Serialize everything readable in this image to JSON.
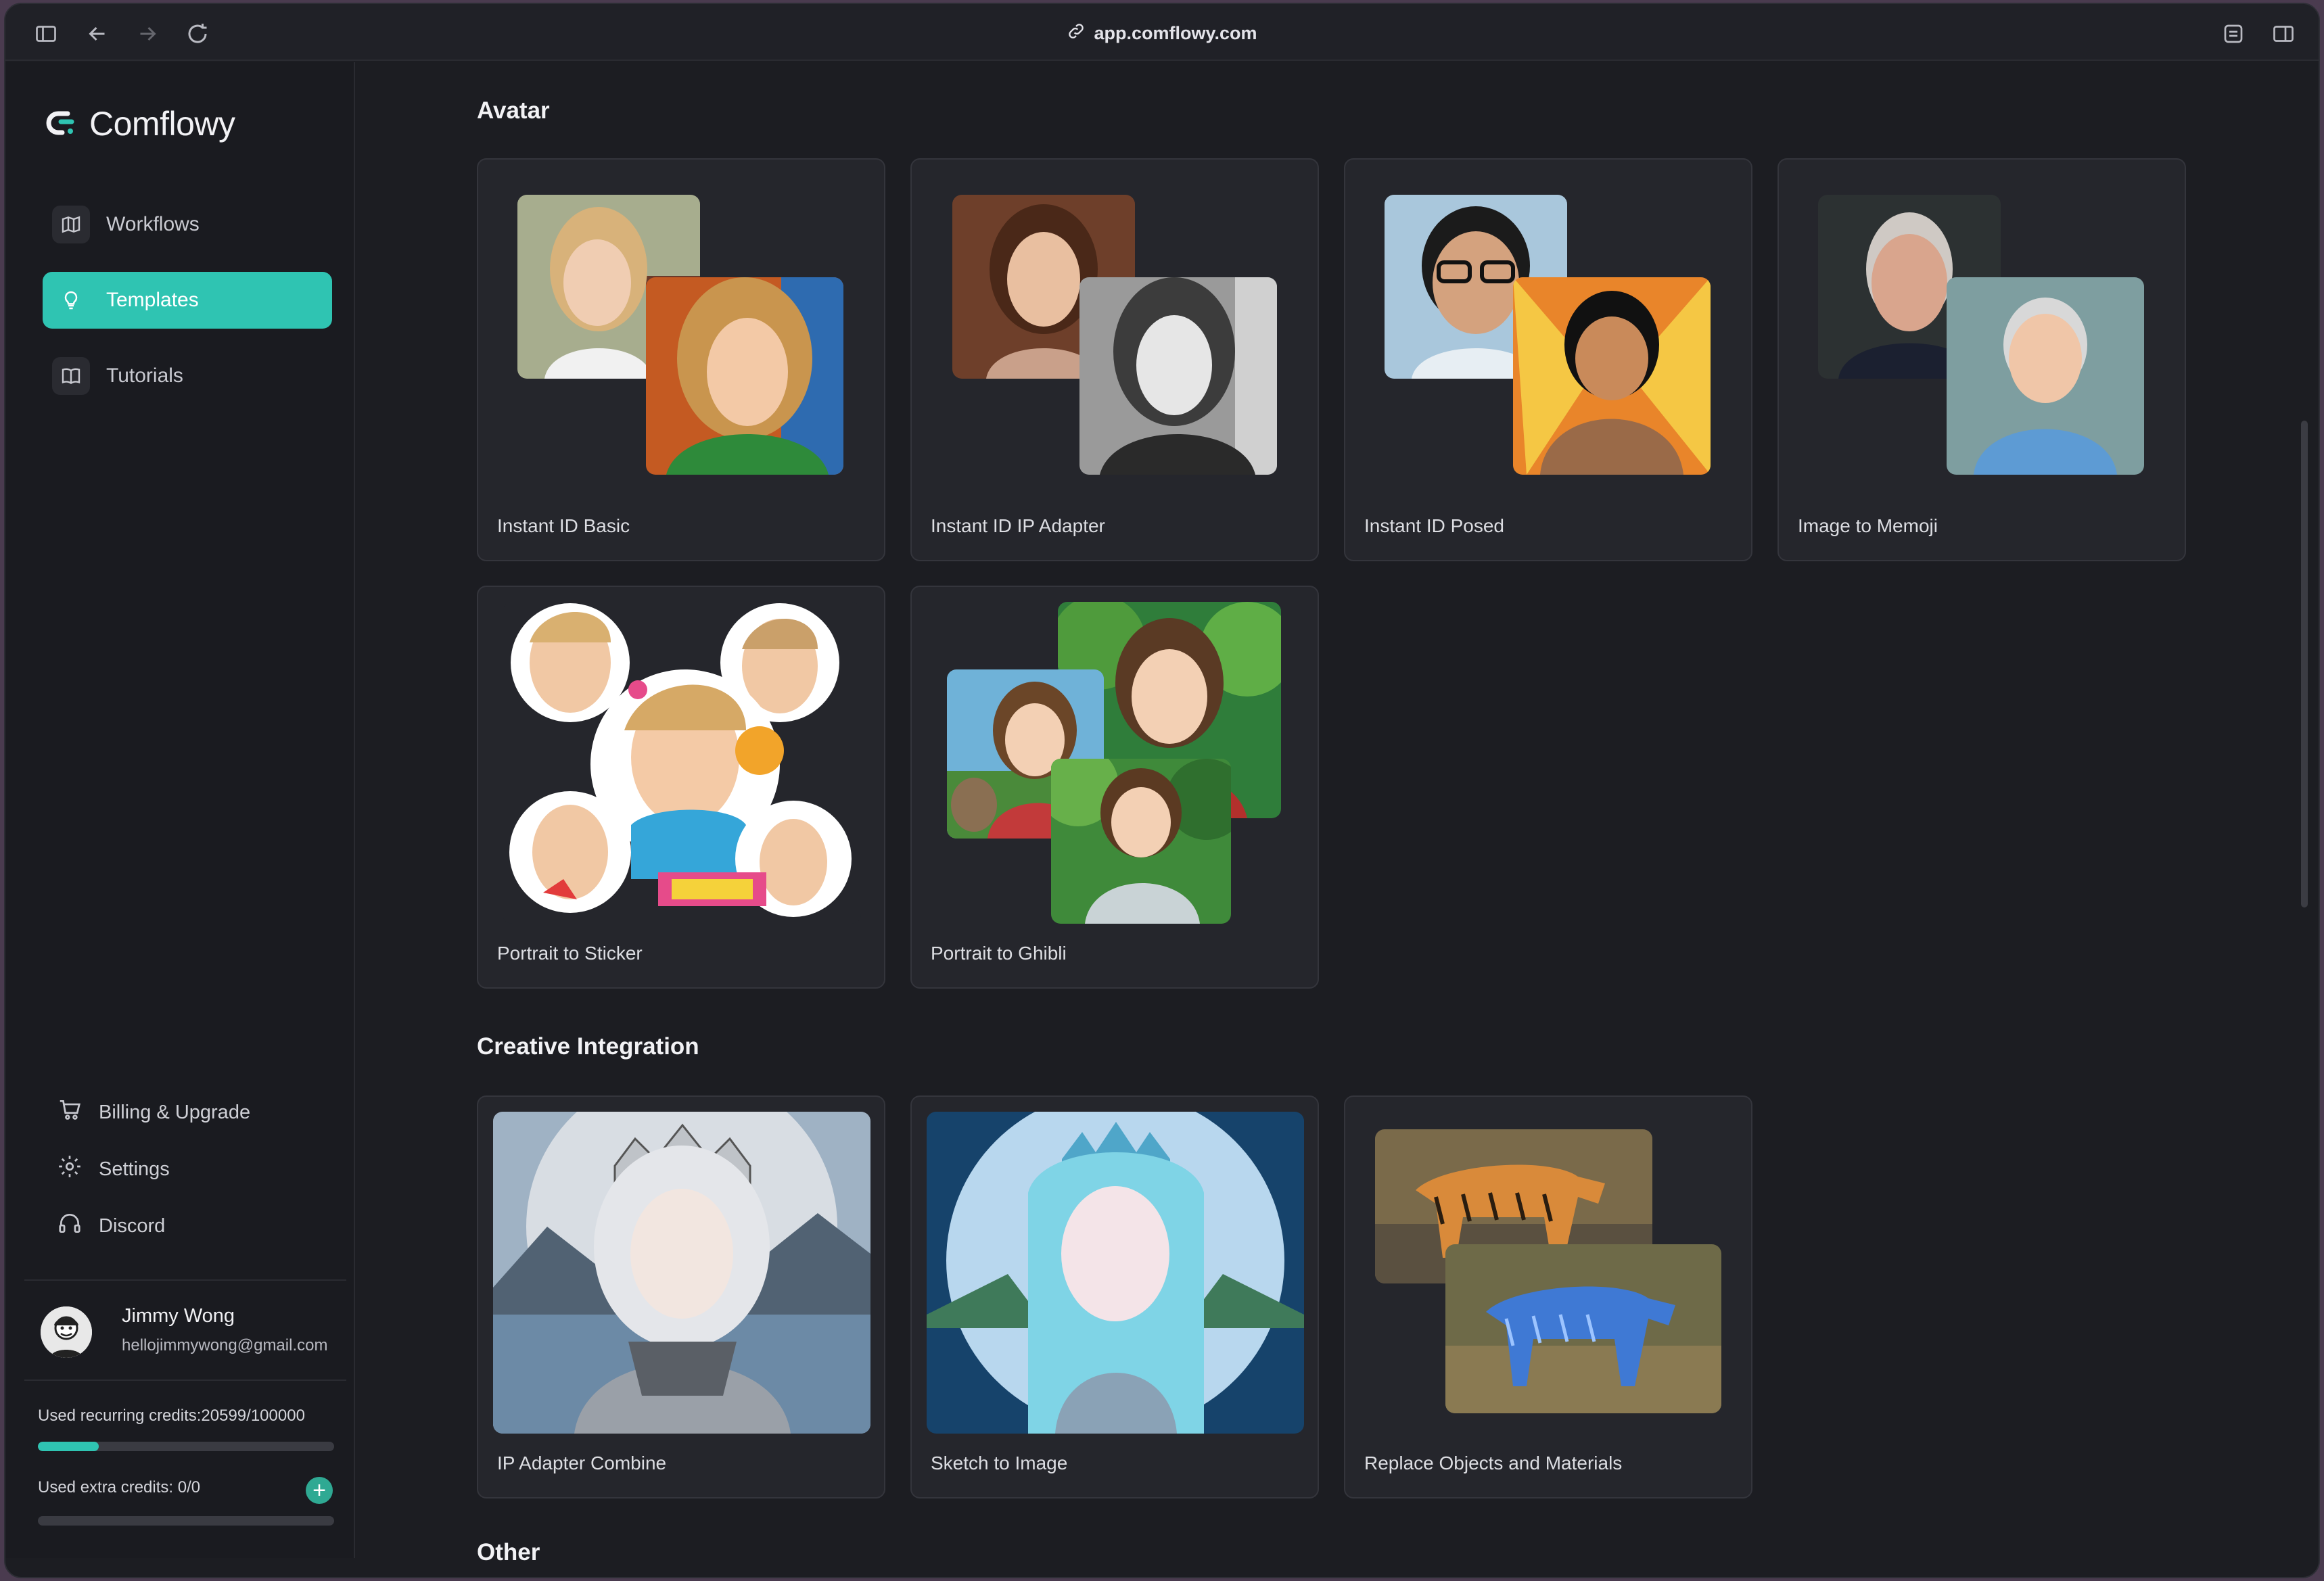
{
  "browser": {
    "url": "app.comflowy.com",
    "icons": [
      "sidebar-toggle-icon",
      "back-icon",
      "forward-icon",
      "reload-icon",
      "link-icon",
      "extension-icon",
      "split-view-icon"
    ]
  },
  "app": {
    "name": "Comflowy",
    "accent": "#2fc4b2"
  },
  "sidebar": {
    "nav": [
      {
        "label": "Workflows",
        "icon": "map-icon",
        "active": false
      },
      {
        "label": "Templates",
        "icon": "lightbulb-icon",
        "active": true
      },
      {
        "label": "Tutorials",
        "icon": "book-icon",
        "active": false
      }
    ],
    "bottom": [
      {
        "label": "Billing & Upgrade",
        "icon": "cart-icon"
      },
      {
        "label": "Settings",
        "icon": "gear-icon"
      },
      {
        "label": "Discord",
        "icon": "headset-icon"
      }
    ],
    "user": {
      "name": "Jimmy Wong",
      "email": "hellojimmywong@gmail.com"
    },
    "credits": {
      "recurring_label": "Used recurring credits:20599/100000",
      "recurring_used": 20599,
      "recurring_total": 100000,
      "extra_label": "Used extra credits: 0/0",
      "extra_used": 0,
      "add_label": "+"
    }
  },
  "sections": [
    {
      "title": "Avatar",
      "cards": [
        {
          "label": "Instant ID Basic"
        },
        {
          "label": "Instant ID IP Adapter"
        },
        {
          "label": "Instant ID Posed"
        },
        {
          "label": "Image to Memoji"
        },
        {
          "label": "Portrait to Sticker"
        },
        {
          "label": "Portrait to Ghibli"
        }
      ]
    },
    {
      "title": "Creative Integration",
      "cards": [
        {
          "label": "IP Adapter Combine"
        },
        {
          "label": "Sketch to Image"
        },
        {
          "label": "Replace Objects and Materials"
        }
      ]
    },
    {
      "title": "Other",
      "cards": []
    }
  ]
}
